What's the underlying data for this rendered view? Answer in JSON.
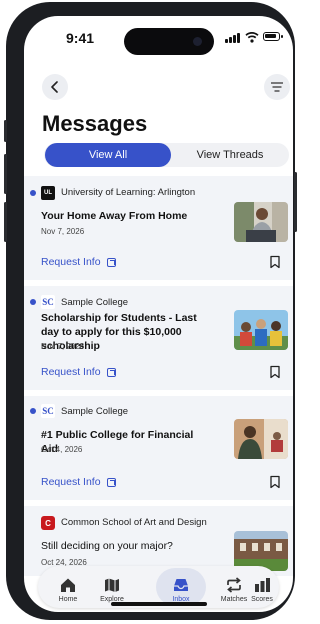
{
  "status_bar": {
    "time": "9:41"
  },
  "header": {
    "title": "Messages"
  },
  "segments": {
    "view_all": "View All",
    "view_threads": "View Threads",
    "selected": "View All"
  },
  "accent_color": "#3752c9",
  "messages": [
    {
      "sender": "University of Learning: Arlington",
      "logo_text": "UL",
      "title": "Your Home Away From Home",
      "date": "Nov 7, 2026",
      "cta": "Request Info",
      "unread": true
    },
    {
      "sender": "Sample College",
      "logo_text": "SC",
      "title": "Scholarship for Students - Last day to apply for this $10,000 scholarship",
      "date": "Nov 7, 2026",
      "cta": "Request Info",
      "unread": true
    },
    {
      "sender": "Sample College",
      "logo_text": "SC",
      "title": "#1 Public College for Financial Aid",
      "date": "Oct 4, 2026",
      "cta": "Request Info",
      "unread": true
    },
    {
      "sender": "Common School of Art and Design",
      "logo_text": "C",
      "title": "Still deciding on your major?",
      "date": "Oct 24, 2026",
      "unread": false
    }
  ],
  "tabbar": {
    "items": [
      {
        "label": "Home",
        "icon": "house-icon"
      },
      {
        "label": "Explore",
        "icon": "map-icon"
      },
      {
        "label": "Inbox",
        "icon": "inbox-icon"
      },
      {
        "label": "Matches",
        "icon": "repeat-icon"
      },
      {
        "label": "Scores",
        "icon": "bar-chart-icon"
      }
    ],
    "selected": "Inbox"
  }
}
